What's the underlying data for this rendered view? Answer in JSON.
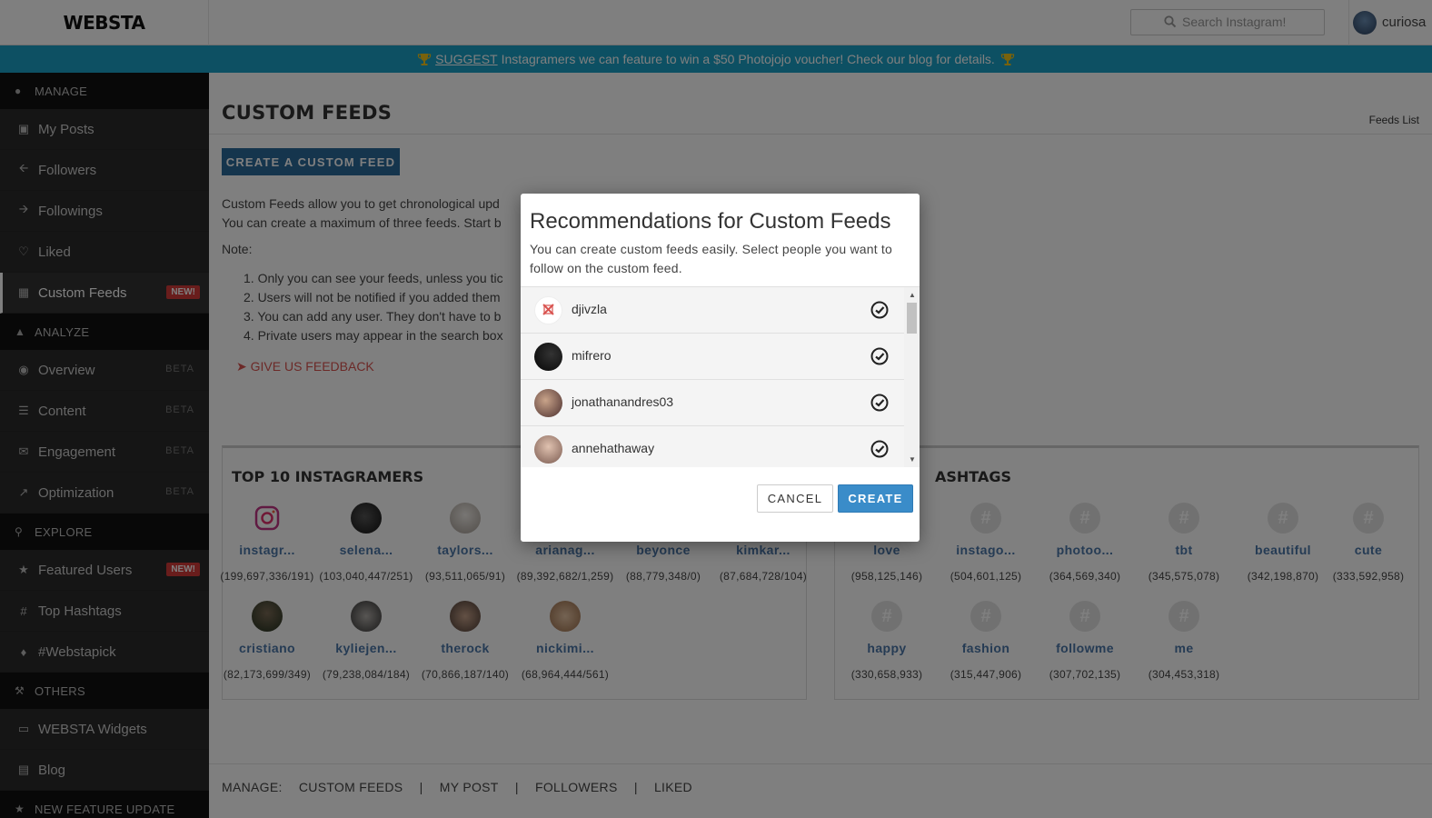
{
  "header": {
    "logo": "WEBSTA",
    "search_placeholder": "Search Instagram!",
    "username": "curiosa"
  },
  "banner": {
    "link": "SUGGEST",
    "text": "Instagramers we can feature to win a $50 Photojojo voucher! Check our blog for details."
  },
  "sidebar": {
    "sections": [
      {
        "title": "MANAGE",
        "items": [
          {
            "label": "My Posts"
          },
          {
            "label": "Followers"
          },
          {
            "label": "Followings"
          },
          {
            "label": "Liked"
          },
          {
            "label": "Custom Feeds",
            "badge": "NEW!"
          }
        ]
      },
      {
        "title": "ANALYZE",
        "items": [
          {
            "label": "Overview",
            "badge": "BETA"
          },
          {
            "label": "Content",
            "badge": "BETA"
          },
          {
            "label": "Engagement",
            "badge": "BETA"
          },
          {
            "label": "Optimization",
            "badge": "BETA"
          }
        ]
      },
      {
        "title": "EXPLORE",
        "items": [
          {
            "label": "Featured Users",
            "badge": "NEW!"
          },
          {
            "label": "Top Hashtags"
          },
          {
            "label": "#Webstapick"
          }
        ]
      },
      {
        "title": "OTHERS",
        "items": [
          {
            "label": "WEBSTA Widgets"
          },
          {
            "label": "Blog"
          }
        ]
      },
      {
        "title": "NEW FEATURE UPDATE",
        "items": []
      }
    ]
  },
  "main": {
    "title": "CUSTOM FEEDS",
    "breadcrumb": "Feeds List",
    "create_button": "CREATE A CUSTOM FEED",
    "desc_line1": "Custom Feeds allow you to get chronological upd",
    "desc_line2": "You can create a maximum of three feeds. Start b",
    "note_label": "Note:",
    "notes": [
      "1. Only you can see your feeds, unless you tic",
      "2. Users will not be notified if you added them",
      "3. You can add any user. They don't have to b",
      "4. Private users may appear in the search box"
    ],
    "feedback": "GIVE US FEEDBACK"
  },
  "top_instagramers": {
    "title": "TOP 10 INSTAGRAMERS",
    "people": [
      {
        "name": "instagr...",
        "stats": "(199,697,336/191)"
      },
      {
        "name": "selena...",
        "stats": "(103,040,447/251)"
      },
      {
        "name": "taylors...",
        "stats": "(93,511,065/91)"
      },
      {
        "name": "arianag...",
        "stats": "(89,392,682/1,259)"
      },
      {
        "name": "beyonce",
        "stats": "(88,779,348/0)"
      },
      {
        "name": "kimkar...",
        "stats": "(87,684,728/104)"
      },
      {
        "name": "cristiano",
        "stats": "(82,173,699/349)"
      },
      {
        "name": "kyliejen...",
        "stats": "(79,238,084/184)"
      },
      {
        "name": "therock",
        "stats": "(70,866,187/140)"
      },
      {
        "name": "nickimi...",
        "stats": "(68,964,444/561)"
      }
    ]
  },
  "top_hashtags": {
    "title": "ASHTAGS",
    "tags": [
      {
        "name": "love",
        "stats": "(958,125,146)"
      },
      {
        "name": "instago...",
        "stats": "(504,601,125)"
      },
      {
        "name": "photoo...",
        "stats": "(364,569,340)"
      },
      {
        "name": "tbt",
        "stats": "(345,575,078)"
      },
      {
        "name": "beautiful",
        "stats": "(342,198,870)"
      },
      {
        "name": "cute",
        "stats": "(333,592,958)"
      },
      {
        "name": "happy",
        "stats": "(330,658,933)"
      },
      {
        "name": "fashion",
        "stats": "(315,447,906)"
      },
      {
        "name": "followme",
        "stats": "(307,702,135)"
      },
      {
        "name": "me",
        "stats": "(304,453,318)"
      }
    ]
  },
  "footer": {
    "manage": "MANAGE:",
    "links": [
      "CUSTOM FEEDS",
      "|",
      "MY POST",
      "|",
      "FOLLOWERS",
      "|",
      "LIKED"
    ]
  },
  "modal": {
    "title": "Recommendations for Custom Feeds",
    "subtitle": "You can create custom feeds easily. Select people you want to follow on the custom feed.",
    "users": [
      {
        "name": "djivzla"
      },
      {
        "name": "mifrero"
      },
      {
        "name": "jonathanandres03"
      },
      {
        "name": "annehathaway"
      }
    ],
    "cancel": "CANCEL",
    "create": "CREATE"
  },
  "colors": {
    "banner": "#1ba1c6",
    "sidebar": "#2a2a2a",
    "accent_button": "#3a8cc9",
    "new_badge": "#d23b38",
    "link": "#4a76a8"
  }
}
